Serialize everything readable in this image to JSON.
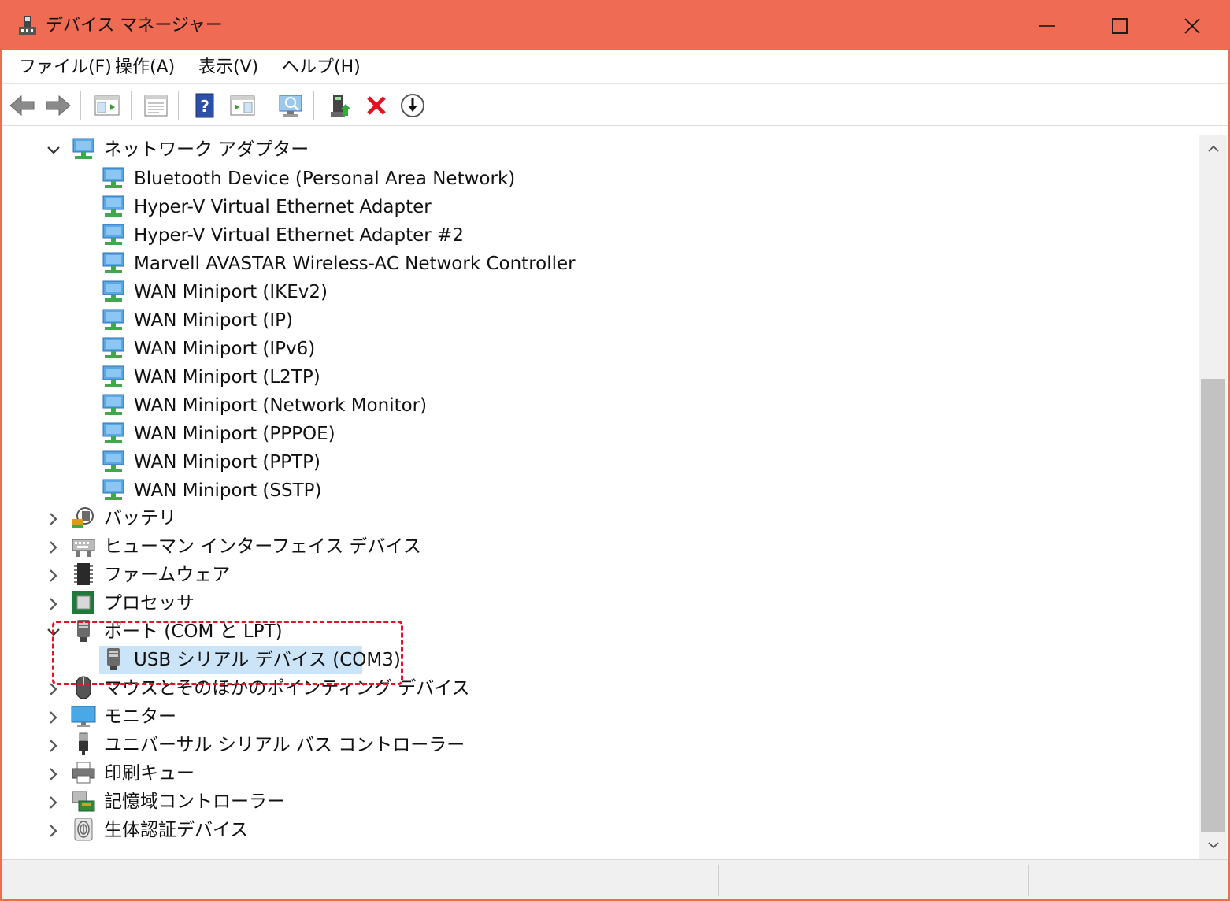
{
  "window": {
    "title": "デバイス マネージャー",
    "accent_color": "#f06b53"
  },
  "menu": {
    "file": "ファイル(F)",
    "action": "操作(A)",
    "view": "表示(V)",
    "help": "ヘルプ(H)"
  },
  "toolbar": {
    "icons": [
      "back-arrow-icon",
      "forward-arrow-icon",
      "console-tree-icon",
      "properties-icon",
      "help-icon",
      "action-pane-icon",
      "scan-hardware-icon",
      "update-driver-icon",
      "uninstall-icon",
      "disable-device-icon"
    ]
  },
  "tree": {
    "network": {
      "label": "ネットワーク アダプター",
      "children": [
        "Bluetooth Device (Personal Area Network)",
        "Hyper-V Virtual Ethernet Adapter",
        "Hyper-V Virtual Ethernet Adapter #2",
        "Marvell AVASTAR Wireless-AC Network Controller",
        "WAN Miniport (IKEv2)",
        "WAN Miniport (IP)",
        "WAN Miniport (IPv6)",
        "WAN Miniport (L2TP)",
        "WAN Miniport (Network Monitor)",
        "WAN Miniport (PPPOE)",
        "WAN Miniport (PPTP)",
        "WAN Miniport (SSTP)"
      ]
    },
    "battery": "バッテリ",
    "hid": "ヒューマン インターフェイス デバイス",
    "firmware": "ファームウェア",
    "processor": "プロセッサ",
    "ports": {
      "label": "ポート (COM と LPT)",
      "child": "USB シリアル デバイス (COM3)"
    },
    "mouse": "マウスとそのほかのポインティング デバイス",
    "monitor": "モニター",
    "usb": "ユニバーサル シリアル バス コントローラー",
    "print": "印刷キュー",
    "storage": "記憶域コントローラー",
    "biometric": "生体認証デバイス"
  },
  "annotation": {
    "color": "#e81123"
  },
  "selection": {
    "color": "#cce4f7"
  }
}
